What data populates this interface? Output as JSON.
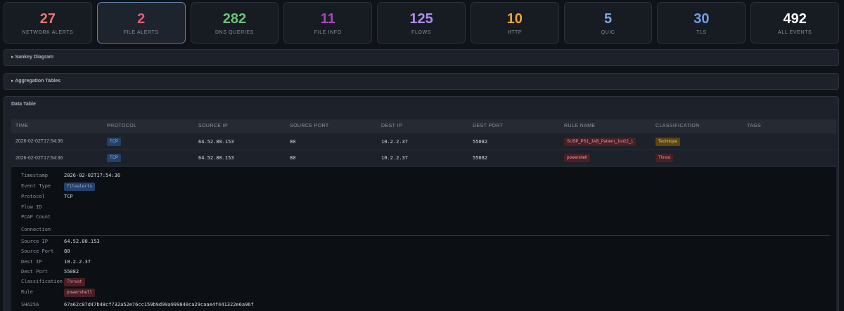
{
  "stats": [
    {
      "label": "NETWORK ALERTS",
      "value": "27",
      "color": "#e8776e"
    },
    {
      "label": "FILE ALERTS",
      "value": "2",
      "color": "#e05d75"
    },
    {
      "label": "DNS QUERIES",
      "value": "282",
      "color": "#6ec27a"
    },
    {
      "label": "FILE INFO",
      "value": "11",
      "color": "#a646b8"
    },
    {
      "label": "FLOWS",
      "value": "125",
      "color": "#b28af0"
    },
    {
      "label": "HTTP",
      "value": "10",
      "color": "#f0a23c"
    },
    {
      "label": "QUIC",
      "value": "5",
      "color": "#7aa7e8"
    },
    {
      "label": "TLS",
      "value": "30",
      "color": "#6f9ee6"
    },
    {
      "label": "ALL EVENTS",
      "value": "492",
      "color": "#ffffff"
    }
  ],
  "panels": {
    "sankey": "▸ Sankey Diagram",
    "aggregation": "▸ Aggregation Tables",
    "data_table": "Data Table"
  },
  "table": {
    "headers": [
      "TIME",
      "PROTOCOL",
      "SOURCE IP",
      "SOURCE PORT",
      "DEST IP",
      "DEST PORT",
      "RULE NAME",
      "CLASSIFICATION",
      "TAGS"
    ],
    "rows": [
      {
        "time": "2026-02-02T17:54:36",
        "protocol": "TCP",
        "src_ip": "64.52.80.153",
        "src_port": "80",
        "dst_ip": "10.2.2.37",
        "dst_port": "55082",
        "rule": "SUSP_PS1_JAB_Pattern_Jun22_1",
        "classification": "Technique"
      },
      {
        "time": "2026-02-02T17:54:36",
        "protocol": "TCP",
        "src_ip": "64.52.80.153",
        "src_port": "80",
        "dst_ip": "10.2.2.37",
        "dst_port": "55082",
        "rule": "powershell",
        "classification": "Threat"
      }
    ]
  },
  "detail": {
    "timestamp_label": "Timestamp",
    "timestamp": "2026-02-02T17:54:36",
    "event_type_label": "Event Type",
    "event_type": "filealerts",
    "protocol_label": "Protocol",
    "protocol": "TCP",
    "flow_id_label": "Flow ID",
    "pcap_label": "PCAP Count",
    "connection_label": "Connection",
    "src_ip_label": "Source IP",
    "src_ip": "64.52.80.153",
    "src_port_label": "Source Port",
    "src_port": "80",
    "dst_ip_label": "Dest IP",
    "dst_ip": "10.2.2.37",
    "dst_port_label": "Dest Port",
    "dst_port": "55082",
    "classification_label": "Classification",
    "classification": "Threat",
    "rule_label": "Rule",
    "rule": "powershell",
    "sha_label": "SHA256",
    "sha": "67a62c87d47b48cf732a52e76cc159b9d99a999840ca29caae4f441322e6a96f"
  }
}
